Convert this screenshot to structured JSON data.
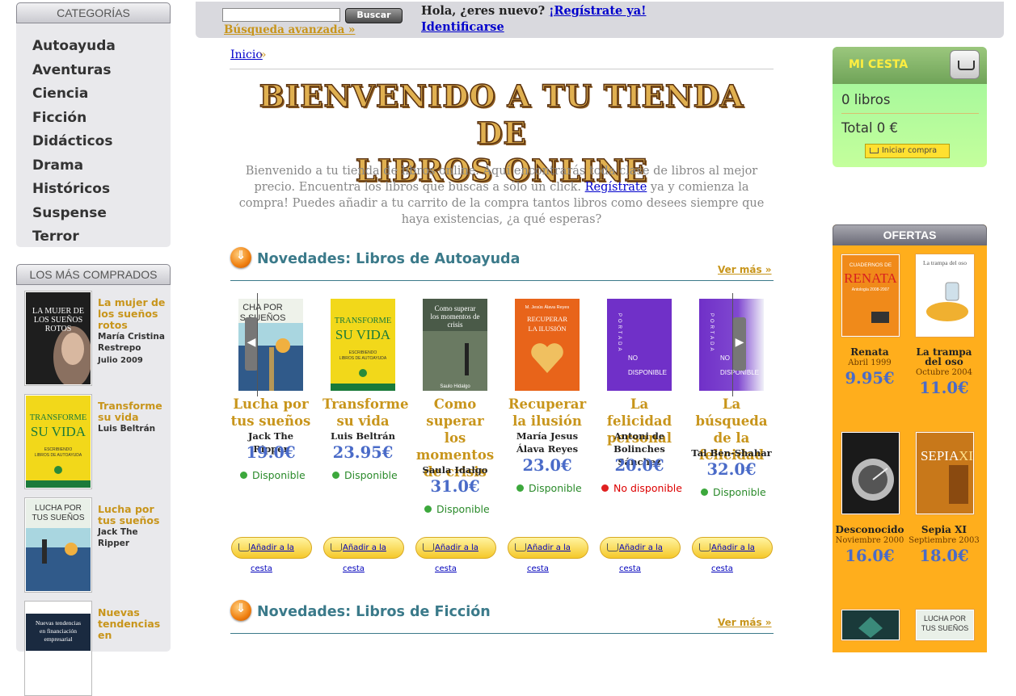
{
  "sidebar": {
    "categories_title": "CATEGORÍAS",
    "categories": [
      "Autoayuda",
      "Aventuras",
      "Ciencia",
      "Ficción",
      "Didácticos",
      "Drama",
      "Históricos",
      "Suspense",
      "Terror"
    ],
    "bestsellers_title": "LOS MÁS COMPRADOS",
    "bestsellers": [
      {
        "title": "La mujer de los sueños rotos",
        "author": "María Cristina Restrepo",
        "date": "Julio 2009"
      },
      {
        "title": "Transforme su vida",
        "author": "Luis Beltrán",
        "date": ""
      },
      {
        "title": "Lucha por tus sueños",
        "author": "Jack The Ripper",
        "date": ""
      },
      {
        "title": "Nuevas tendencias en",
        "author": "",
        "date": ""
      }
    ]
  },
  "topbar": {
    "search_placeholder": "",
    "search_button": "Buscar",
    "advanced_search": "Búsqueda avanzada »",
    "greeting": "Hola, ¿eres nuevo?",
    "register_link": "¡Regístrate ya!",
    "login_link": "Identificarse"
  },
  "breadcrumb": {
    "home": "Inicio",
    "sep": "»"
  },
  "welcome": {
    "heading_line1": "BIENVENIDO A TU TIENDA DE",
    "heading_line2": "LIBROS ONLINE",
    "intro_before": "Bienvenido a tu tienda de libros online. Aquí encontrarás toda clase de libros al mejor precio. Encuentra los libros que buscas a sólo un click.",
    "intro_link": "Regístrate",
    "intro_after": "ya y comienza la compra! Puedes añadir a tu carrito de la compra tantos libros como desees siempre que haya existencias, ¿a qué esperas?"
  },
  "sections": [
    {
      "title": "Novedades: Libros de Autoayuda",
      "more": "Ver más »"
    },
    {
      "title": "Novedades: Libros de Ficción",
      "more": "Ver más »"
    }
  ],
  "books": [
    {
      "title": "Lucha por tus sueños",
      "author": "Jack The Ripper",
      "price": "19.0€",
      "stock": "Disponible",
      "available": true
    },
    {
      "title": "Transforme su vida",
      "author": "Luis Beltrán",
      "price": "23.95€",
      "stock": "Disponible",
      "available": true
    },
    {
      "title": "Como superar los momentos de crisis",
      "author": "Saula Idalgo",
      "price": "31.0€",
      "stock": "Disponible",
      "available": true
    },
    {
      "title": "Recuperar la ilusión",
      "author": "María Jesus Álava Reyes",
      "price": "23.0€",
      "stock": "Disponible",
      "available": true
    },
    {
      "title": "La felicidad personal",
      "author": "Antoni de Bolinches Sánchez",
      "price": "20.0€",
      "stock": "No disponible",
      "available": false
    },
    {
      "title": "La búsqueda de la felicidad",
      "author": "Tal Ben-Shahar",
      "price": "32.0€",
      "stock": "Disponible",
      "available": true
    }
  ],
  "add_to_cart": "Añadir a la cesta",
  "covers": {
    "c1_l1": "CHA POR",
    "c1_l2": "S SUEÑOS",
    "c2_l1": "TRANSFORME",
    "c2_l2": "SU VIDA",
    "c2_l3": "ESCRIBIENDO",
    "c2_l4": "LIBROS DE AUTOAYUDA",
    "c3_l1": "Como superar",
    "c3_l2": "los momentos de",
    "c3_l3": "crisis",
    "c3_l4": "Saulo Hidalgo",
    "c4_l1": "M. Jesús Álava Reyes",
    "c4_l2": "RECUPERAR",
    "c4_l3": "LA ILUSIÓN",
    "portada": "PORTADA",
    "no": "NO",
    "disp": "DISPONIBLE",
    "b1_l1": "LA MUJER DE",
    "b1_l2": "LOS SUEÑOS",
    "b1_l3": "ROTOS",
    "b3_l1": "LUCHA POR",
    "b3_l2": "TUS SUEÑOS",
    "b4_l1": "Nuevas tendencias",
    "b4_l2": "en financiación",
    "b4_l3": "empresarial",
    "o1_l1": "CUADERNOS DE",
    "o1_l2": "RENATA",
    "o1_l3": "Antología 2008-2007",
    "o2_l1": "La trampa del oso",
    "o4_l1": "SEPIA",
    "o4_l2": "XI"
  },
  "cart": {
    "title": "MI CESTA",
    "count": "0 libros",
    "total": "Total 0 €",
    "button": "Iniciar compra"
  },
  "offers": {
    "title": "OFERTAS",
    "items": [
      {
        "title": "Renata",
        "date": "Abril 1999",
        "price": "9.95€"
      },
      {
        "title": "La trampa del oso",
        "date": "Octubre 2004",
        "price": "11.0€"
      },
      {
        "title": "Desconocido",
        "date": "Noviembre 2000",
        "price": "16.0€"
      },
      {
        "title": "Sepia XI",
        "date": "Septiembre 2003",
        "price": "18.0€"
      }
    ]
  },
  "colors": {
    "accent": "#c8951b",
    "link": "#0000cc",
    "price": "#4a6bc8",
    "section": "#3b7a8a",
    "cart": "#9cf59c",
    "offers": "#ffae1c"
  }
}
